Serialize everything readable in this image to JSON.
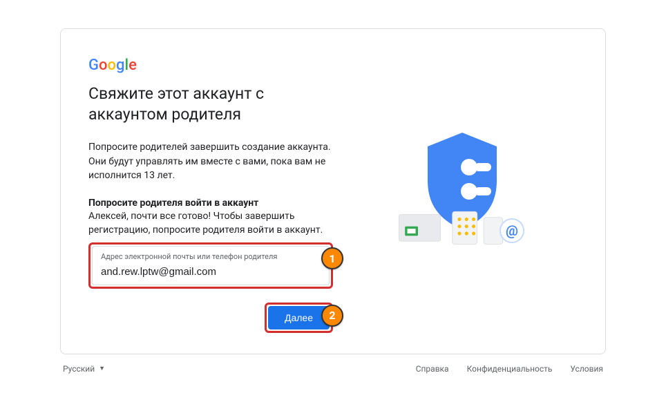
{
  "logo": {
    "g": "G",
    "o1": "o",
    "o2": "o",
    "g2": "g",
    "l": "l",
    "e": "e"
  },
  "heading": "Свяжите этот аккаунт с аккаунтом родителя",
  "description": "Попросите родителей завершить создание аккаунта. Они будут управлять им вместе с вами, пока вам не исполнится 13 лет.",
  "subhead": "Попросите родителя войти в аккаунт",
  "subdesc": "Алексей, почти все готово! Чтобы завершить регистрацию, попросите родителя войти в аккаунт.",
  "input": {
    "label": "Адрес электронной почты или телефон родителя",
    "value": "and.rew.lptw@gmail.com"
  },
  "button": "Далее",
  "markers": {
    "m1": "1",
    "m2": "2"
  },
  "footer": {
    "language": "Русский",
    "links": {
      "help": "Справка",
      "privacy": "Конфиденциальность",
      "terms": "Условия"
    }
  },
  "at": "@"
}
